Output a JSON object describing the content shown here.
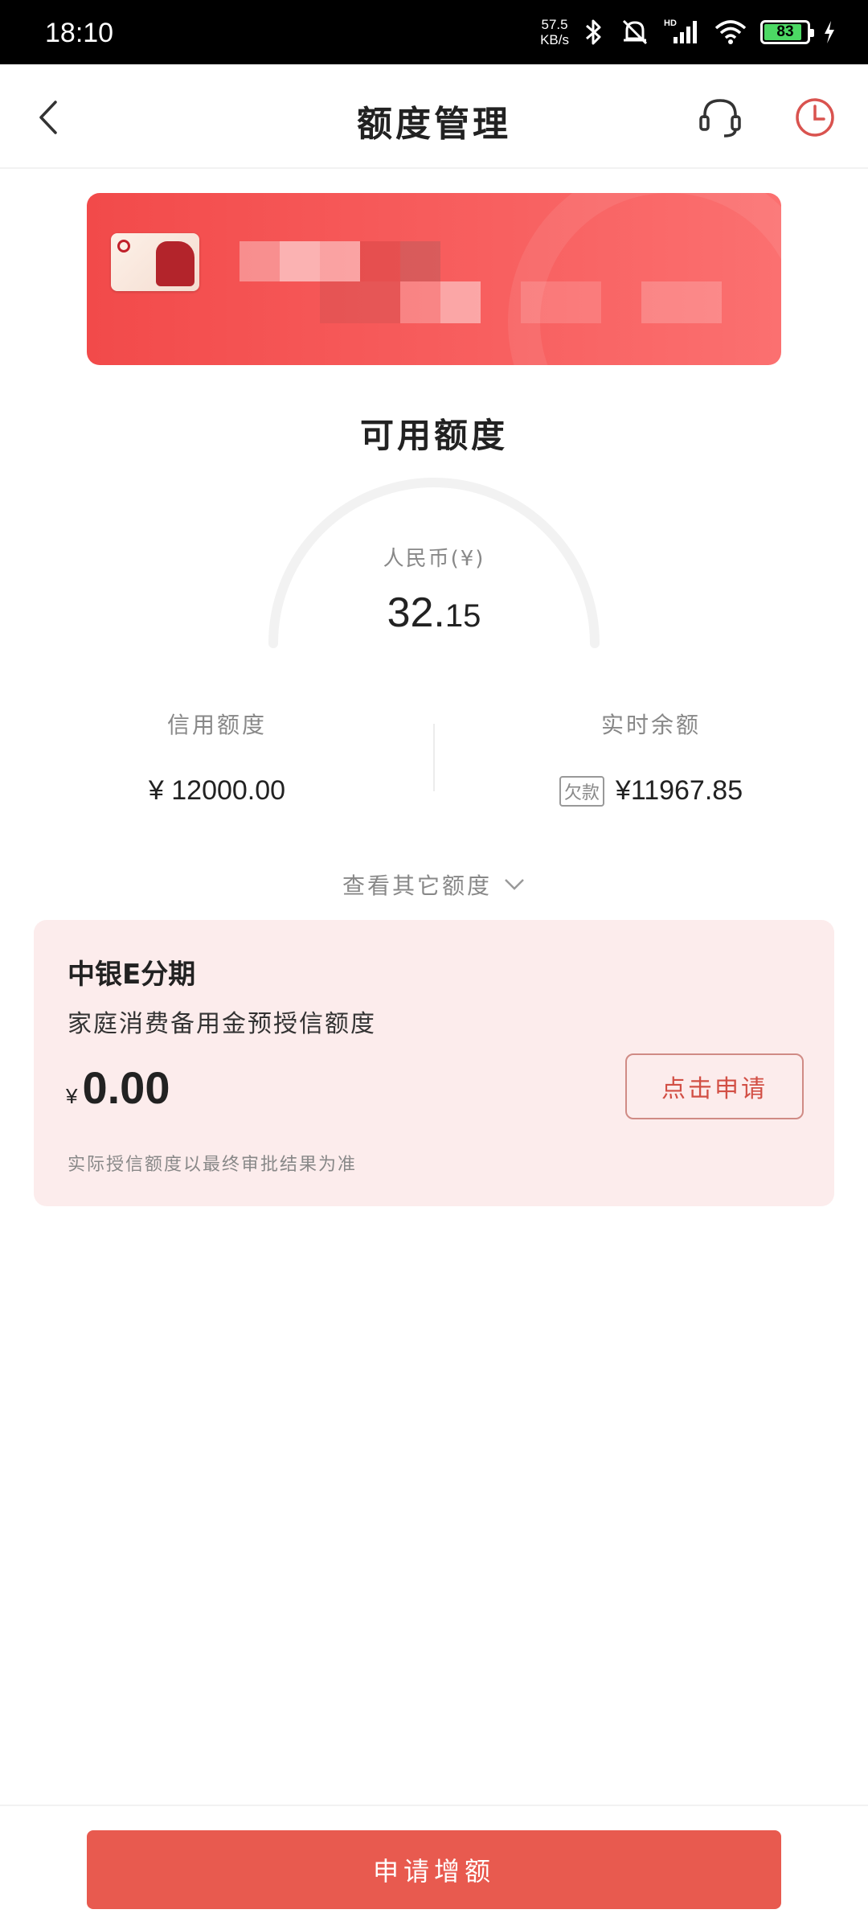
{
  "status_bar": {
    "time": "18:10",
    "net_speed_value": "57.5",
    "net_speed_unit": "KB/s",
    "network_label": "HD",
    "battery_level": "83"
  },
  "header": {
    "title": "额度管理",
    "icons": [
      "back-arrow-icon",
      "customer-service-headset-icon",
      "clock-history-icon"
    ],
    "accent_color": "#d9534f"
  },
  "available": {
    "title": "可用额度",
    "currency_label": "人民币(¥)",
    "amount_int": "32.",
    "amount_dec": "15"
  },
  "stats": {
    "credit_limit": {
      "label": "信用额度",
      "value": "¥ 12000.00"
    },
    "balance": {
      "label": "实时余额",
      "badge": "欠款",
      "value": "¥11967.85"
    }
  },
  "view_other": {
    "label": "查看其它额度"
  },
  "installment": {
    "title": "中银E分期",
    "subtitle": "家庭消费备用金预授信额度",
    "currency_symbol": "¥",
    "amount": "0.00",
    "apply_label": "点击申请",
    "note": "实际授信额度以最终审批结果为准"
  },
  "bottom": {
    "increase_label": "申请增额"
  }
}
